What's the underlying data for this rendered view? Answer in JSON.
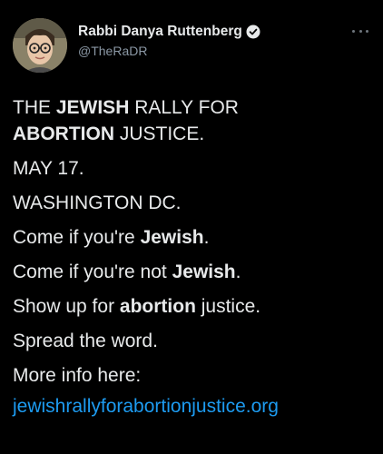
{
  "author": {
    "display_name": "Rabbi Danya Ruttenberg",
    "handle": "@TheRaDR",
    "avatar_icon": "avatar-photo",
    "verified_icon": "verified-badge-icon"
  },
  "tweet": {
    "line1_a": "THE ",
    "line1_b": "JEWISH",
    "line1_c": " RALLY FOR",
    "line2_a": "ABORTION",
    "line2_b": " JUSTICE.",
    "line3": "MAY 17.",
    "line4": "WASHINGTON DC.",
    "line5_a": "Come if you're ",
    "line5_b": "Jewish",
    "line5_c": ".",
    "line6_a": "Come if you're not ",
    "line6_b": "Jewish",
    "line6_c": ".",
    "line7_a": "Show up for ",
    "line7_b": "abortion",
    "line7_c": " justice.",
    "line8": "Spread the word.",
    "line9": "More info here:",
    "link": "jewishrallyforabortionjustice.org"
  },
  "colors": {
    "background": "#000000",
    "text": "#e7e9ea",
    "secondary": "#8b98a5",
    "link": "#1d9bf0"
  }
}
